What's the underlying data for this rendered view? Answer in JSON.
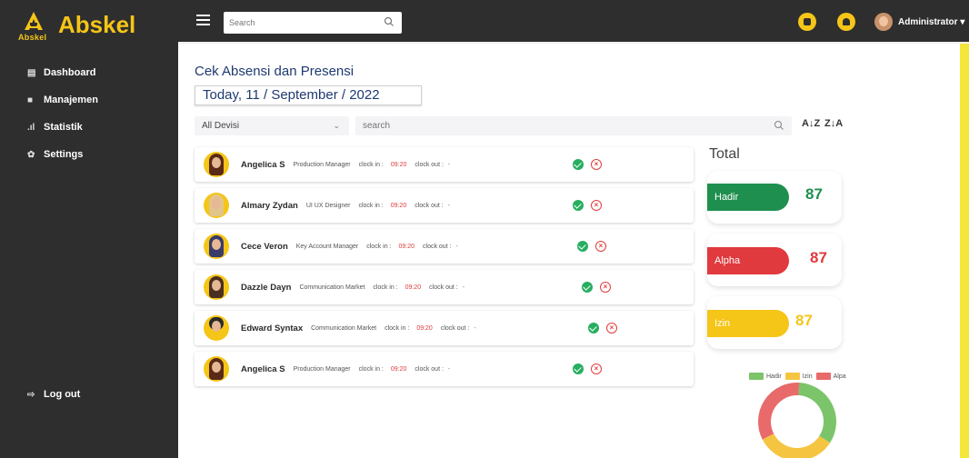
{
  "brand": {
    "name": "Abskel",
    "logo_sub": "Abskel",
    "logo_icon": "abskel-logo"
  },
  "sidebar": {
    "items": [
      {
        "label": "Dashboard",
        "icon": "dashboard-icon"
      },
      {
        "label": "Manajemen",
        "icon": "folder-icon"
      },
      {
        "label": "Statistik",
        "icon": "chart-icon"
      },
      {
        "label": "Settings",
        "icon": "gear-icon"
      }
    ],
    "logout": {
      "label": "Log out",
      "icon": "logout-icon"
    }
  },
  "topbar": {
    "search_placeholder": "Search",
    "user": "Administrator"
  },
  "main": {
    "title": "Cek Absensi dan Presensi",
    "date": "Today, 11 / September / 2022",
    "devisi_selected": "All Devisi",
    "search_placeholder": "search",
    "sort_asc": "A↓Z",
    "sort_desc": "Z↓A"
  },
  "attendance": {
    "clock_in_label": "clock in :",
    "clock_out_label": "clock out :",
    "rows": [
      {
        "name": "Angelica S",
        "role": "Production Manager",
        "clock_in": "09:20",
        "clock_out": "-"
      },
      {
        "name": "Almary Zydan",
        "role": "UI UX Designer",
        "clock_in": "09:20",
        "clock_out": "-"
      },
      {
        "name": "Cece Veron",
        "role": "Key Account Manager",
        "clock_in": "09:20",
        "clock_out": "-"
      },
      {
        "name": "Dazzle Dayn",
        "role": "Communication Market",
        "clock_in": "09:20",
        "clock_out": "-"
      },
      {
        "name": "Edward Syntax",
        "role": "Communication Market",
        "clock_in": "09:20",
        "clock_out": "-"
      },
      {
        "name": "Angelica S",
        "role": "Production Manager",
        "clock_in": "09:20",
        "clock_out": "-"
      }
    ]
  },
  "totals": {
    "title": "Total",
    "items": [
      {
        "label": "Hadir",
        "count": "87",
        "color": "#1e8f4e"
      },
      {
        "label": "Alpha",
        "count": "87",
        "color": "#e0393e"
      },
      {
        "label": "Izin",
        "count": "87",
        "color": "#f5c518"
      }
    ]
  },
  "legend": [
    "Hadir",
    "Izin",
    "Alpa"
  ],
  "chart_data": {
    "type": "pie",
    "categories": [
      "Hadir",
      "Izin",
      "Alpa"
    ],
    "values": [
      87,
      87,
      87
    ],
    "colors": [
      "#7cc46a",
      "#f5c542",
      "#e86a6a"
    ]
  }
}
